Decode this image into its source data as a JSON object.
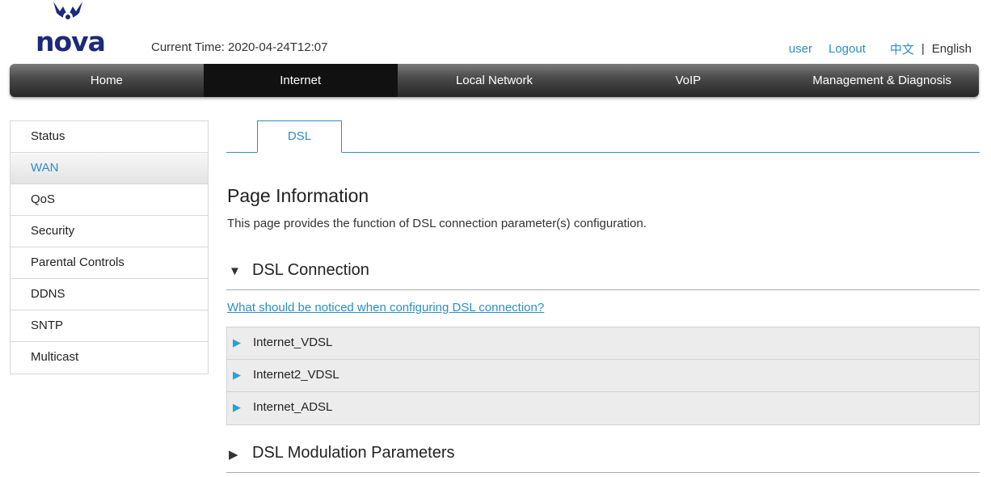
{
  "header": {
    "logo_text": "nova",
    "current_time_label": "Current Time: 2020-04-24T12:07",
    "user": "user",
    "logout": "Logout",
    "lang_zh": "中文",
    "lang_sep": "|",
    "lang_en": "English"
  },
  "mainnav": {
    "items": [
      {
        "label": "Home",
        "active": false
      },
      {
        "label": "Internet",
        "active": true
      },
      {
        "label": "Local Network",
        "active": false
      },
      {
        "label": "VoIP",
        "active": false
      },
      {
        "label": "Management & Diagnosis",
        "active": false
      }
    ]
  },
  "sidebar": {
    "items": [
      {
        "label": "Status",
        "active": false
      },
      {
        "label": "WAN",
        "active": true
      },
      {
        "label": "QoS",
        "active": false
      },
      {
        "label": "Security",
        "active": false
      },
      {
        "label": "Parental Controls",
        "active": false
      },
      {
        "label": "DDNS",
        "active": false
      },
      {
        "label": "SNTP",
        "active": false
      },
      {
        "label": "Multicast",
        "active": false
      }
    ]
  },
  "content": {
    "tab": "DSL",
    "page_title": "Page Information",
    "page_desc": "This page provides the function of DSL connection parameter(s) configuration.",
    "section1": {
      "arrow": "▼",
      "title": "DSL Connection"
    },
    "help_link": "What should be noticed when configuring DSL connection?",
    "connections": [
      "Internet_VDSL",
      "Internet2_VDSL",
      "Internet_ADSL"
    ],
    "section2": {
      "arrow": "▶",
      "title": "DSL Modulation Parameters"
    }
  },
  "colors": {
    "accent": "#2a8fc4",
    "brand": "#1b2a7a",
    "nav_active": "#111111"
  }
}
